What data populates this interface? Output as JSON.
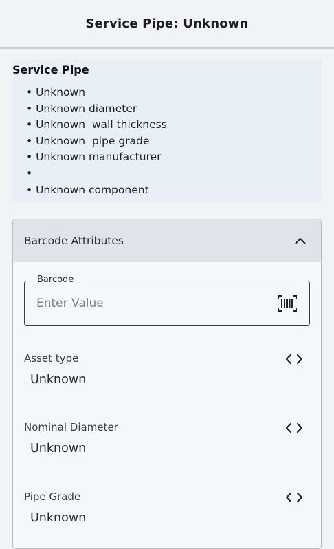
{
  "header": {
    "title": "Service Pipe: Unknown"
  },
  "summary": {
    "title": "Service Pipe",
    "items": [
      "Unknown",
      "Unknown diameter",
      "Unknown  wall thickness",
      "Unknown  pipe grade",
      "Unknown manufacturer",
      "",
      "Unknown component"
    ]
  },
  "barcode_section": {
    "title": "Barcode Attributes",
    "expanded": true,
    "barcode": {
      "label": "Barcode",
      "placeholder": "Enter Value",
      "value": ""
    },
    "attributes": [
      {
        "label": "Asset type",
        "value": "Unknown"
      },
      {
        "label": "Nominal Diameter",
        "value": "Unknown"
      },
      {
        "label": "Pipe Grade",
        "value": "Unknown"
      }
    ]
  },
  "icons": {
    "collapse": "chevron-up-icon",
    "scan": "barcode-scan-icon",
    "select": "code-chevrons-icon"
  }
}
